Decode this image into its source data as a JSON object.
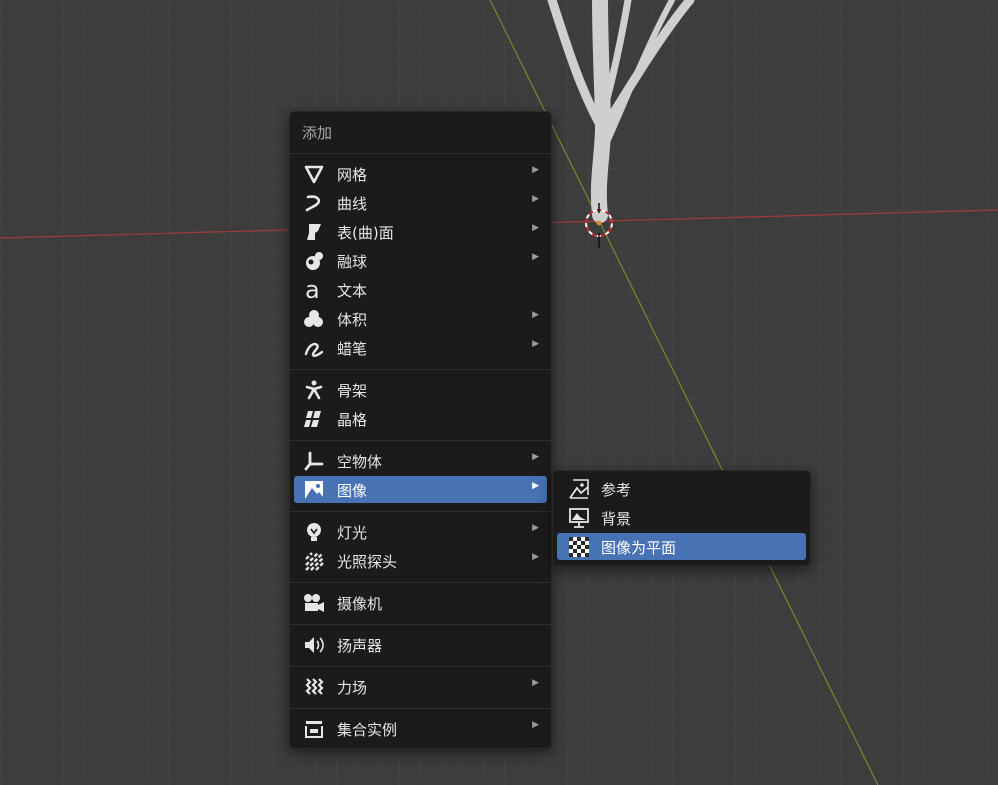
{
  "add_menu": {
    "title": "添加",
    "items": [
      {
        "label": "网格",
        "icon": "mesh-icon",
        "submenu": true
      },
      {
        "label": "曲线",
        "icon": "curve-icon",
        "submenu": true
      },
      {
        "label": "表(曲)面",
        "icon": "surface-icon",
        "submenu": true
      },
      {
        "label": "融球",
        "icon": "metaball-icon",
        "submenu": true
      },
      {
        "label": "文本",
        "icon": "text-icon",
        "submenu": false
      },
      {
        "label": "体积",
        "icon": "volume-icon",
        "submenu": true
      },
      {
        "label": "蜡笔",
        "icon": "grease-pencil-icon",
        "submenu": true
      },
      {
        "label": "骨架",
        "icon": "armature-icon",
        "submenu": false
      },
      {
        "label": "晶格",
        "icon": "lattice-icon",
        "submenu": false
      },
      {
        "label": "空物体",
        "icon": "empty-icon",
        "submenu": true
      },
      {
        "label": "图像",
        "icon": "image-icon",
        "submenu": true,
        "active": true
      },
      {
        "label": "灯光",
        "icon": "light-icon",
        "submenu": true
      },
      {
        "label": "光照探头",
        "icon": "light-probe-icon",
        "submenu": true
      },
      {
        "label": "摄像机",
        "icon": "camera-icon",
        "submenu": false
      },
      {
        "label": "扬声器",
        "icon": "speaker-icon",
        "submenu": false
      },
      {
        "label": "力场",
        "icon": "force-field-icon",
        "submenu": true
      },
      {
        "label": "集合实例",
        "icon": "collection-instance-icon",
        "submenu": true
      }
    ]
  },
  "image_submenu": {
    "items": [
      {
        "label": "参考",
        "icon": "image-reference-icon"
      },
      {
        "label": "背景",
        "icon": "image-background-icon"
      },
      {
        "label": "图像为平面",
        "icon": "image-plane-icon",
        "active": true
      }
    ]
  },
  "colors": {
    "menu_bg": "#1b1b1b",
    "highlight": "#4772b3",
    "viewport_bg": "#3d3d3d",
    "x_axis": "#a33a3a",
    "y_axis": "#6d8f2a"
  }
}
